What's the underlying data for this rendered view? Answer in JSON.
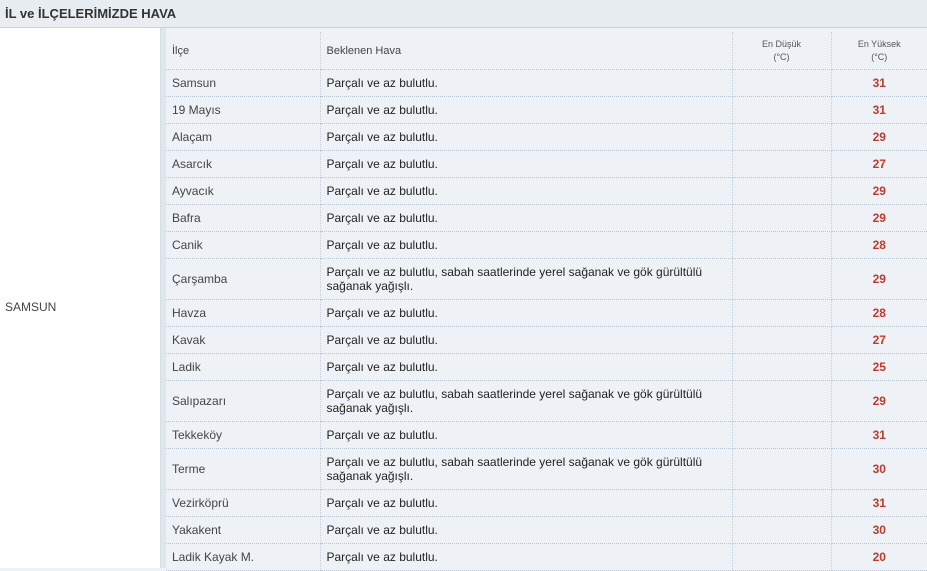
{
  "header": {
    "title": "İL ve İLÇELERİMİZDE HAVA"
  },
  "province": "SAMSUN",
  "columns": {
    "district": "İlçe",
    "expected": "Beklenen Hava",
    "min_line1": "En Düşük",
    "min_line2": "(°C)",
    "max_line1": "En Yüksek",
    "max_line2": "(°C)"
  },
  "rows": [
    {
      "district": "Samsun",
      "weather": "Parçalı ve az bulutlu.",
      "min": "",
      "max": "31"
    },
    {
      "district": "19 Mayıs",
      "weather": "Parçalı ve az bulutlu.",
      "min": "",
      "max": "31"
    },
    {
      "district": "Alaçam",
      "weather": "Parçalı ve az bulutlu.",
      "min": "",
      "max": "29"
    },
    {
      "district": "Asarcık",
      "weather": "Parçalı ve az bulutlu.",
      "min": "",
      "max": "27"
    },
    {
      "district": "Ayvacık",
      "weather": "Parçalı ve az bulutlu.",
      "min": "",
      "max": "29"
    },
    {
      "district": "Bafra",
      "weather": "Parçalı ve az bulutlu.",
      "min": "",
      "max": "29"
    },
    {
      "district": "Canik",
      "weather": "Parçalı ve az bulutlu.",
      "min": "",
      "max": "28"
    },
    {
      "district": "Çarşamba",
      "weather": "Parçalı ve az bulutlu, sabah saatlerinde yerel sağanak ve gök gürültülü sağanak yağışlı.",
      "min": "",
      "max": "29"
    },
    {
      "district": "Havza",
      "weather": "Parçalı ve az bulutlu.",
      "min": "",
      "max": "28"
    },
    {
      "district": "Kavak",
      "weather": "Parçalı ve az bulutlu.",
      "min": "",
      "max": "27"
    },
    {
      "district": "Ladik",
      "weather": "Parçalı ve az bulutlu.",
      "min": "",
      "max": "25"
    },
    {
      "district": "Salıpazarı",
      "weather": "Parçalı ve az bulutlu, sabah saatlerinde yerel sağanak ve gök gürültülü sağanak yağışlı.",
      "min": "",
      "max": "29"
    },
    {
      "district": "Tekkeköy",
      "weather": "Parçalı ve az bulutlu.",
      "min": "",
      "max": "31"
    },
    {
      "district": "Terme",
      "weather": "Parçalı ve az bulutlu, sabah saatlerinde yerel sağanak ve gök gürültülü sağanak yağışlı.",
      "min": "",
      "max": "30"
    },
    {
      "district": "Vezirköprü",
      "weather": "Parçalı ve az bulutlu.",
      "min": "",
      "max": "31"
    },
    {
      "district": "Yakakent",
      "weather": "Parçalı ve az bulutlu.",
      "min": "",
      "max": "30"
    },
    {
      "district": "Ladik Kayak M.",
      "weather": "Parçalı ve az bulutlu.",
      "min": "",
      "max": "20"
    }
  ],
  "colors": {
    "max_temp": "#c0392b",
    "background": "#eef2f6"
  }
}
